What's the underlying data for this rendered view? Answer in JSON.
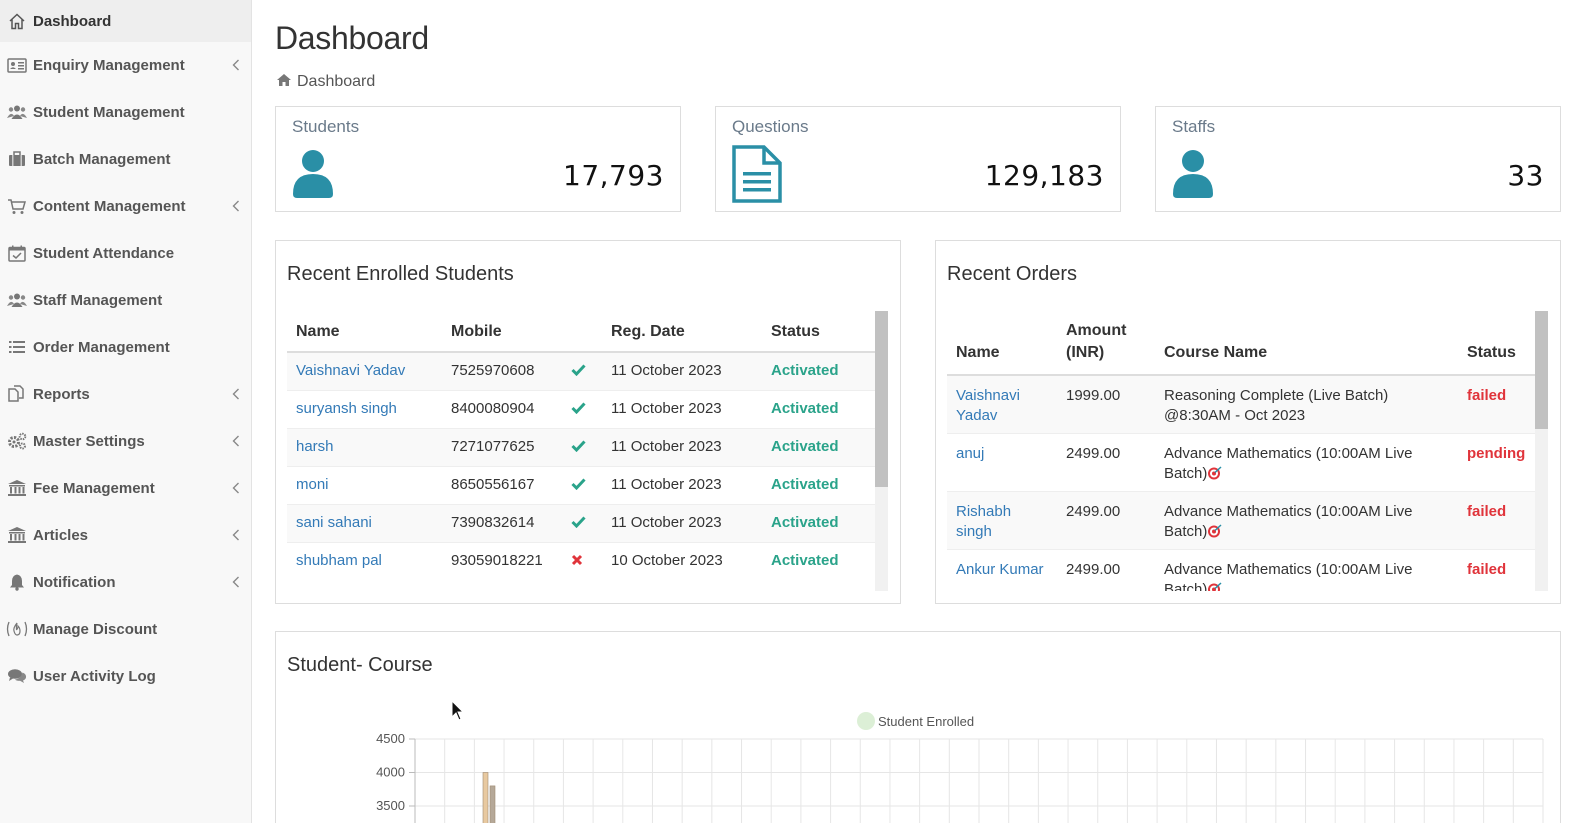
{
  "sidebar": {
    "items": [
      {
        "label": "Dashboard",
        "icon": "home-icon",
        "chevron": false,
        "active": true
      },
      {
        "label": "Enquiry Management",
        "icon": "id-card-icon",
        "chevron": true
      },
      {
        "label": "Student Management",
        "icon": "users-icon",
        "chevron": false
      },
      {
        "label": "Batch Management",
        "icon": "briefcase-icon",
        "chevron": false
      },
      {
        "label": "Content Management",
        "icon": "cart-icon",
        "chevron": true
      },
      {
        "label": "Student Attendance",
        "icon": "calendar-check-icon",
        "chevron": false
      },
      {
        "label": "Staff Management",
        "icon": "users-icon",
        "chevron": false
      },
      {
        "label": "Order Management",
        "icon": "list-icon",
        "chevron": false
      },
      {
        "label": "Reports",
        "icon": "copy-icon",
        "chevron": true
      },
      {
        "label": "Master Settings",
        "icon": "cogs-icon",
        "chevron": true
      },
      {
        "label": "Fee Management",
        "icon": "bank-icon",
        "chevron": true
      },
      {
        "label": "Articles",
        "icon": "bank-icon",
        "chevron": true
      },
      {
        "label": "Notification",
        "icon": "bell-icon",
        "chevron": true
      },
      {
        "label": "Manage Discount",
        "icon": "fire-icon",
        "chevron": false
      },
      {
        "label": "User Activity Log",
        "icon": "comments-icon",
        "chevron": false
      }
    ]
  },
  "header": {
    "title": "Dashboard",
    "breadcrumb": "Dashboard"
  },
  "stats": [
    {
      "title": "Students",
      "value": "17,793",
      "icon": "user-icon"
    },
    {
      "title": "Questions",
      "value": "129,183",
      "icon": "document-icon"
    },
    {
      "title": "Staffs",
      "value": "33",
      "icon": "user-icon"
    }
  ],
  "enrolled": {
    "title": "Recent Enrolled Students",
    "columns": [
      "Name",
      "Mobile",
      "",
      "Reg. Date",
      "Status"
    ],
    "rows": [
      {
        "name": "Vaishnavi Yadav",
        "mobile": "7525970608",
        "verified": true,
        "date": "11 October 2023",
        "status": "Activated"
      },
      {
        "name": "suryansh singh",
        "mobile": "8400080904",
        "verified": true,
        "date": "11 October 2023",
        "status": "Activated"
      },
      {
        "name": "harsh",
        "mobile": "7271077625",
        "verified": true,
        "date": "11 October 2023",
        "status": "Activated"
      },
      {
        "name": "moni",
        "mobile": "8650556167",
        "verified": true,
        "date": "11 October 2023",
        "status": "Activated"
      },
      {
        "name": "sani sahani",
        "mobile": "7390832614",
        "verified": true,
        "date": "11 October 2023",
        "status": "Activated"
      },
      {
        "name": "shubham pal",
        "mobile": "93059018221",
        "verified": false,
        "date": "10 October 2023",
        "status": "Activated"
      }
    ]
  },
  "orders": {
    "title": "Recent Orders",
    "columns": [
      "Name",
      "Amount (INR)",
      "Course Name",
      "Status"
    ],
    "rows": [
      {
        "name": "Vaishnavi Yadav",
        "amount": "1999.00",
        "course": "Reasoning Complete (Live Batch) @8:30AM - Oct 2023",
        "course_emoji": false,
        "status": "failed"
      },
      {
        "name": "anuj",
        "amount": "2499.00",
        "course": "Advance Mathematics (10:00AM Live Batch)",
        "course_emoji": true,
        "status": "pending"
      },
      {
        "name": "Rishabh singh",
        "amount": "2499.00",
        "course": "Advance Mathematics (10:00AM Live Batch)",
        "course_emoji": true,
        "status": "failed"
      },
      {
        "name": "Ankur Kumar",
        "amount": "2499.00",
        "course": "Advance Mathematics (10:00AM Live Batch)",
        "course_emoji": true,
        "status": "failed"
      }
    ]
  },
  "chart_panel": {
    "title": "Student- Course"
  },
  "chart_data": {
    "type": "bar",
    "title": "",
    "legend": "Student Enrolled",
    "legend_position": "top-center",
    "yticks": [
      3500,
      4000,
      4500
    ],
    "ylim": [
      3500,
      4500
    ],
    "grid": true,
    "visible_bars": [
      {
        "value": 4000,
        "color": "#e8c9a0"
      },
      {
        "value": 3800,
        "color": "#b5a898"
      }
    ]
  },
  "colors": {
    "accent": "#2a8fa6",
    "link": "#337ab7",
    "success": "#2aa38a",
    "danger": "#e0343b"
  }
}
